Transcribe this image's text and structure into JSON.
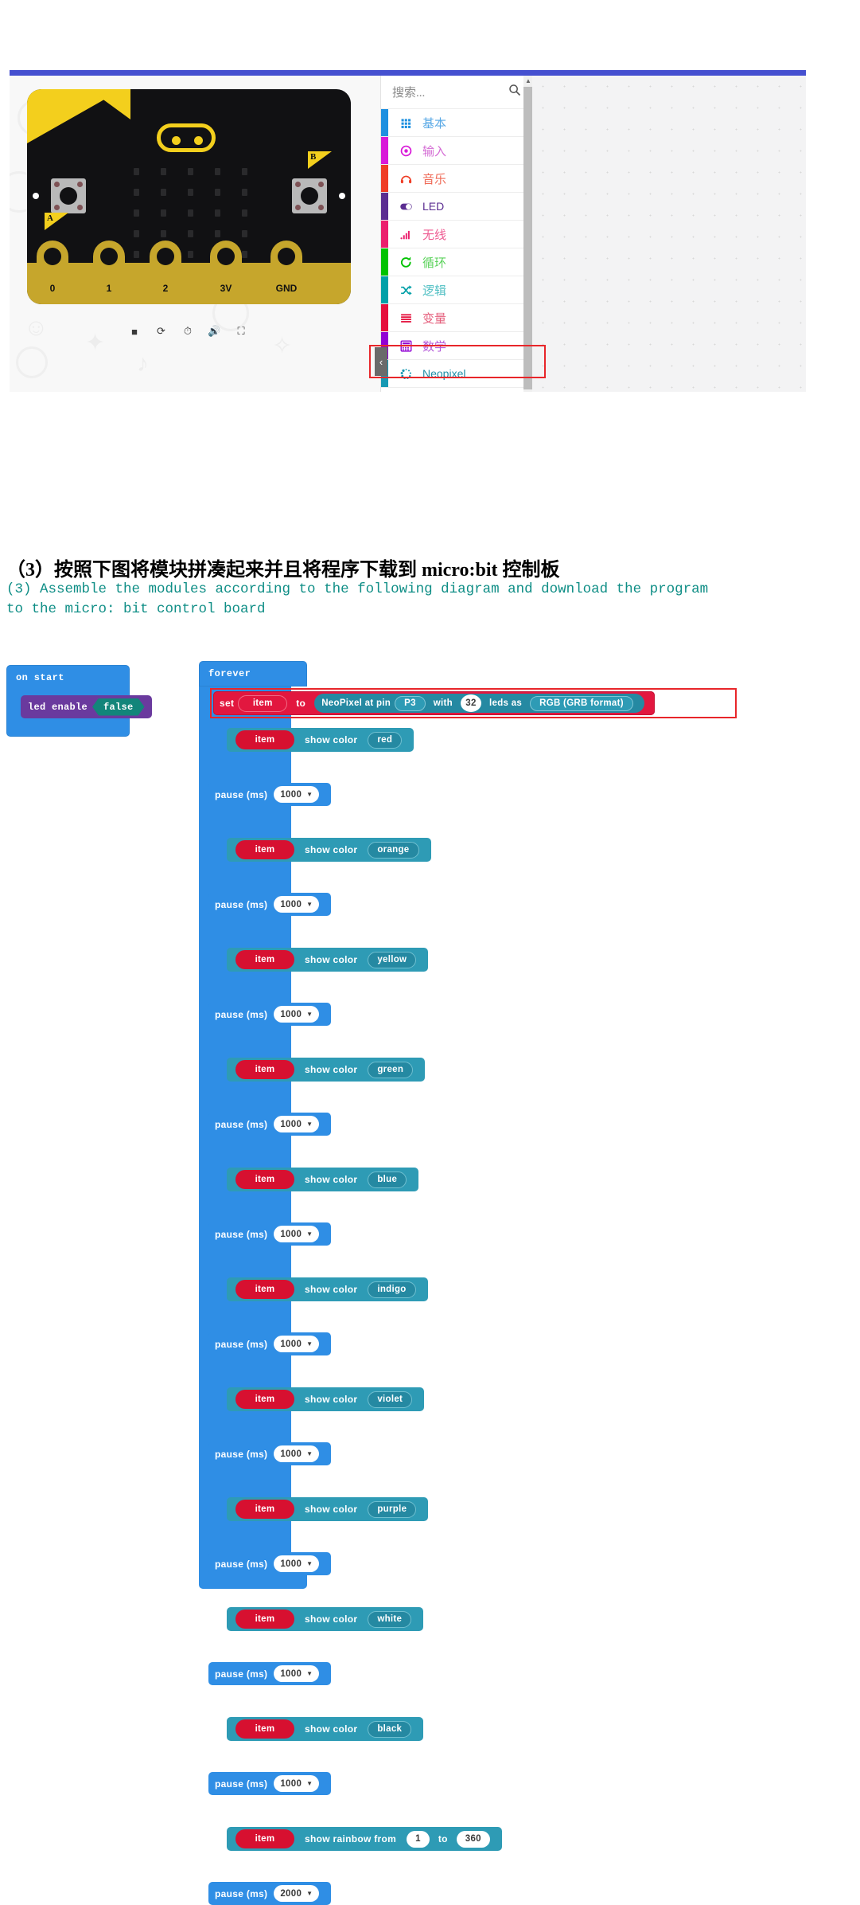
{
  "editor": {
    "simulator": {
      "board_labels": [
        "0",
        "1",
        "2",
        "3V",
        "GND"
      ],
      "button_a_label": "A",
      "button_b_label": "B",
      "toolbar_icons": [
        "stop-icon",
        "restart-icon",
        "slow-motion-icon",
        "mute-icon",
        "fullscreen-icon"
      ]
    },
    "search": {
      "placeholder": "搜索...",
      "icon": "search-icon"
    },
    "categories": [
      {
        "label": "基本",
        "color": "#1e90e0",
        "text_color": "#5aa9e6",
        "icon": "grid-icon",
        "latin": false
      },
      {
        "label": "输入",
        "color": "#d819d8",
        "text_color": "#d46bd4",
        "icon": "target-icon",
        "latin": false
      },
      {
        "label": "音乐",
        "color": "#ef3d25",
        "text_color": "#ef6a57",
        "icon": "headphone-icon",
        "latin": false
      },
      {
        "label": "LED",
        "color": "#5b2d91",
        "text_color": "#5b2d91",
        "icon": "toggle-icon",
        "latin": true
      },
      {
        "label": "无线",
        "color": "#eb1f6d",
        "text_color": "#ee5b92",
        "icon": "signal-icon",
        "latin": false
      },
      {
        "label": "循环",
        "color": "#00c200",
        "text_color": "#5ad25a",
        "icon": "loop-icon",
        "latin": false
      },
      {
        "label": "逻辑",
        "color": "#00a0a8",
        "text_color": "#52c0c4",
        "icon": "shuffle-icon",
        "latin": false
      },
      {
        "label": "变量",
        "color": "#e5103c",
        "text_color": "#e5607d",
        "icon": "lines-icon",
        "latin": false
      },
      {
        "label": "数学",
        "color": "#9100d4",
        "text_color": "#b55ad9",
        "icon": "calculator-icon",
        "latin": false
      },
      {
        "label": "Neopixel",
        "color": "#1799b3",
        "text_color": "#1f8fa8",
        "icon": "neopixel-icon",
        "latin": true
      }
    ],
    "collapse_icon": "chevron-left-icon",
    "highlight_color": "#e8262a"
  },
  "heading": {
    "cn": "（3）按照下图将模块拼凑起来并且将程序下载到 micro:bit 控制板",
    "en": "(3) Assemble the modules according to the following diagram and download the program to the micro: bit control board",
    "en_color": "#0f8e86"
  },
  "program": {
    "on_start": {
      "title": "on start",
      "statement": {
        "label": "led enable",
        "value": "false"
      }
    },
    "forever": {
      "title": "forever",
      "set_block": {
        "set": "set",
        "variable": "item",
        "to": "to",
        "expr_prefix": "NeoPixel at pin",
        "pin": "P3",
        "with": "with",
        "leds_count": "32",
        "leds_as": "leds as",
        "format": "RGB (GRB format)"
      },
      "steps": [
        {
          "kind": "show_color",
          "variable": "item",
          "action": "show color",
          "value": "red",
          "pause_label": "pause (ms)",
          "pause_value": "1000"
        },
        {
          "kind": "show_color",
          "variable": "item",
          "action": "show color",
          "value": "orange",
          "pause_label": "pause (ms)",
          "pause_value": "1000"
        },
        {
          "kind": "show_color",
          "variable": "item",
          "action": "show color",
          "value": "yellow",
          "pause_label": "pause (ms)",
          "pause_value": "1000"
        },
        {
          "kind": "show_color",
          "variable": "item",
          "action": "show color",
          "value": "green",
          "pause_label": "pause (ms)",
          "pause_value": "1000"
        },
        {
          "kind": "show_color",
          "variable": "item",
          "action": "show color",
          "value": "blue",
          "pause_label": "pause (ms)",
          "pause_value": "1000"
        },
        {
          "kind": "show_color",
          "variable": "item",
          "action": "show color",
          "value": "indigo",
          "pause_label": "pause (ms)",
          "pause_value": "1000"
        },
        {
          "kind": "show_color",
          "variable": "item",
          "action": "show color",
          "value": "violet",
          "pause_label": "pause (ms)",
          "pause_value": "1000"
        },
        {
          "kind": "show_color",
          "variable": "item",
          "action": "show color",
          "value": "purple",
          "pause_label": "pause (ms)",
          "pause_value": "1000"
        },
        {
          "kind": "show_color",
          "variable": "item",
          "action": "show color",
          "value": "white",
          "pause_label": "pause (ms)",
          "pause_value": "1000"
        },
        {
          "kind": "show_color",
          "variable": "item",
          "action": "show color",
          "value": "black",
          "pause_label": "pause (ms)",
          "pause_value": "1000"
        },
        {
          "kind": "rainbow",
          "variable": "item",
          "action": "show rainbow from",
          "from": "1",
          "mid": "to",
          "to": "360",
          "pause_label": "pause (ms)",
          "pause_value": "2000"
        }
      ]
    }
  }
}
